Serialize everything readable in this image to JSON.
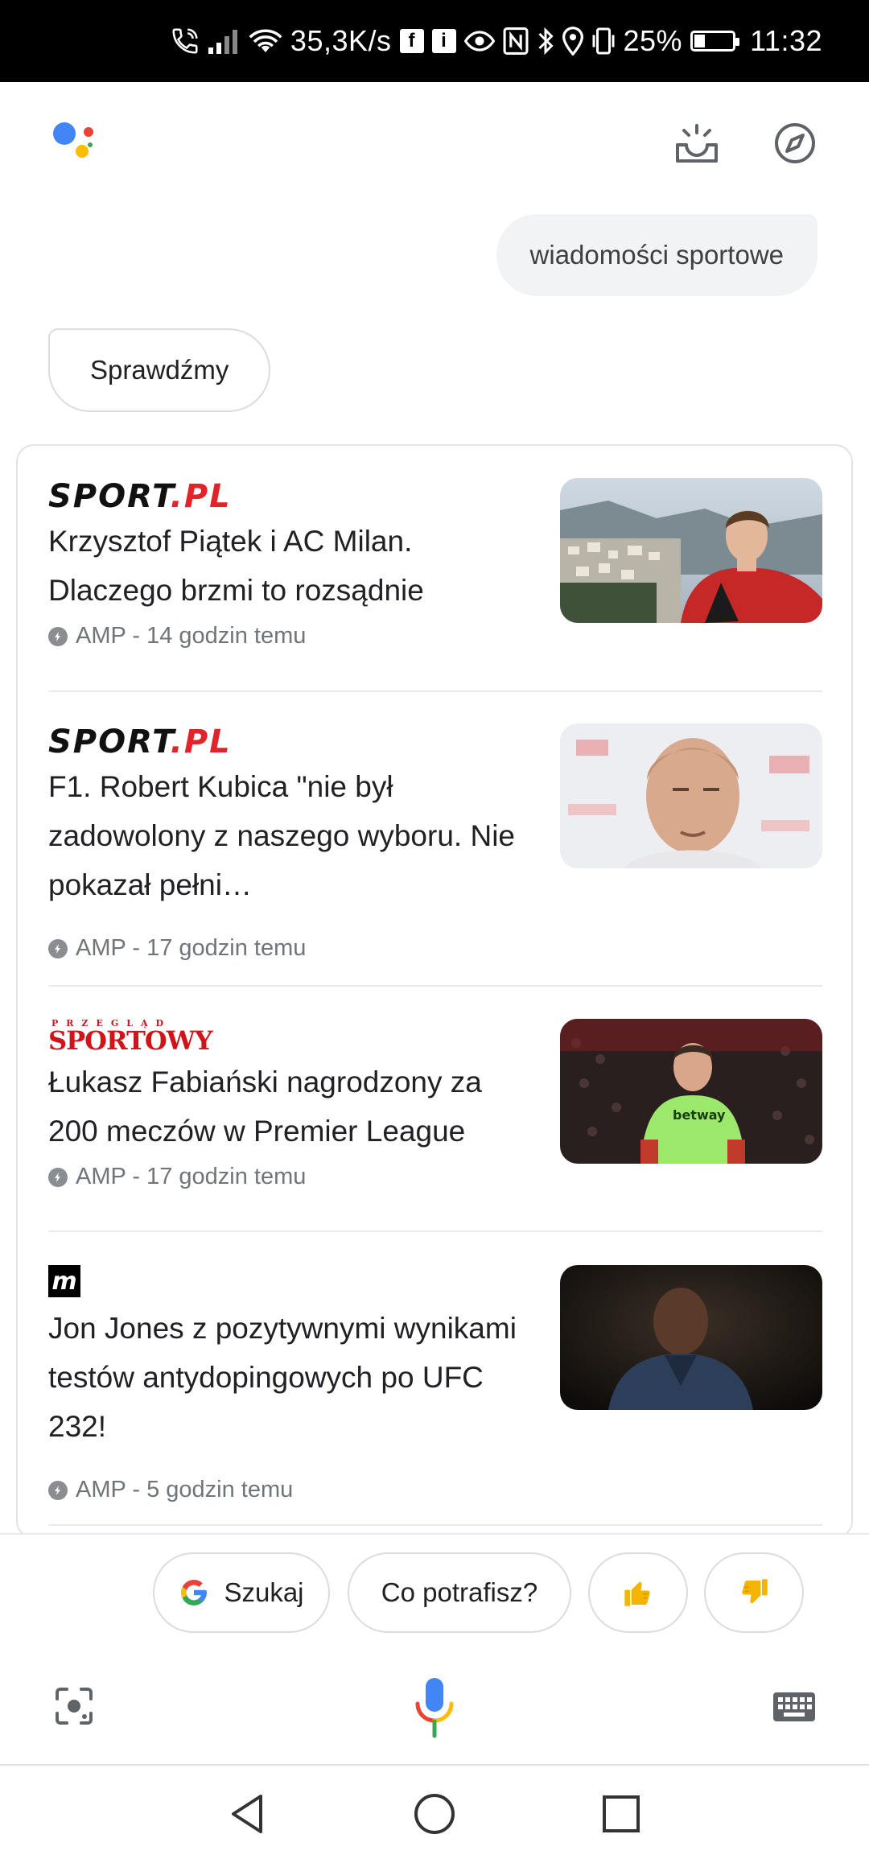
{
  "status_bar": {
    "network_speed": "35,3K/s",
    "battery_percent": "25%",
    "time": "11:32",
    "icons": [
      "phone-wifi-call-icon",
      "signal-icon",
      "wifi-icon",
      "facebook-icon",
      "info-icon",
      "eye-icon",
      "nfc-icon",
      "bluetooth-icon",
      "location-icon",
      "vibrate-icon",
      "battery-icon"
    ]
  },
  "header": {
    "logo": "google-assistant-logo",
    "snapshot_icon": "snapshot-sunrise-icon",
    "explore_icon": "compass-icon"
  },
  "conversation": {
    "user_query": "wiadomości sportowe",
    "assistant_reply": "Sprawdźmy"
  },
  "news": {
    "items": [
      {
        "source": "SPORT.PL",
        "source_dark": "SPORT",
        "source_red": ".PL",
        "headline": "Krzysztof Piątek i AC Milan. Dlaczego brzmi to rozsądnie",
        "meta": "AMP - 14 godzin temu"
      },
      {
        "source": "SPORT.PL",
        "source_dark": "SPORT",
        "source_red": ".PL",
        "headline": "F1. Robert Kubica \"nie był zadowolony z naszego wyboru. Nie pokazał pełni…",
        "meta": "AMP - 17 godzin temu"
      },
      {
        "source": "PRZEGLĄD SPORTOWY",
        "source_top": "PRZEGLĄD",
        "source_bottom": "SPORTOWY",
        "headline": "Łukasz Fabiański nagrodzony za 200 meczów w Premier League",
        "meta": "AMP - 17 godzin temu"
      },
      {
        "source": "m",
        "headline": "Jon Jones z pozytywnymi wynikami testów antydopingowych po UFC 232!",
        "meta": "AMP - 5 godzin temu"
      }
    ]
  },
  "suggestions": {
    "search_label": "Szukaj",
    "capabilities_label": "Co potrafisz?",
    "thumbs_up": "👍",
    "thumbs_down": "👎"
  },
  "input_bar": {
    "lens_icon": "lens-icon",
    "mic_icon": "microphone-icon",
    "keyboard_icon": "keyboard-icon"
  },
  "nav_bar": {
    "back": "back-triangle-icon",
    "home": "home-circle-icon",
    "recents": "recents-square-icon"
  },
  "colors": {
    "google_blue": "#4285F4",
    "google_red": "#EA4335",
    "google_yellow": "#FBBC05",
    "google_green": "#34A853",
    "thumb_yellow": "#F4B400"
  }
}
